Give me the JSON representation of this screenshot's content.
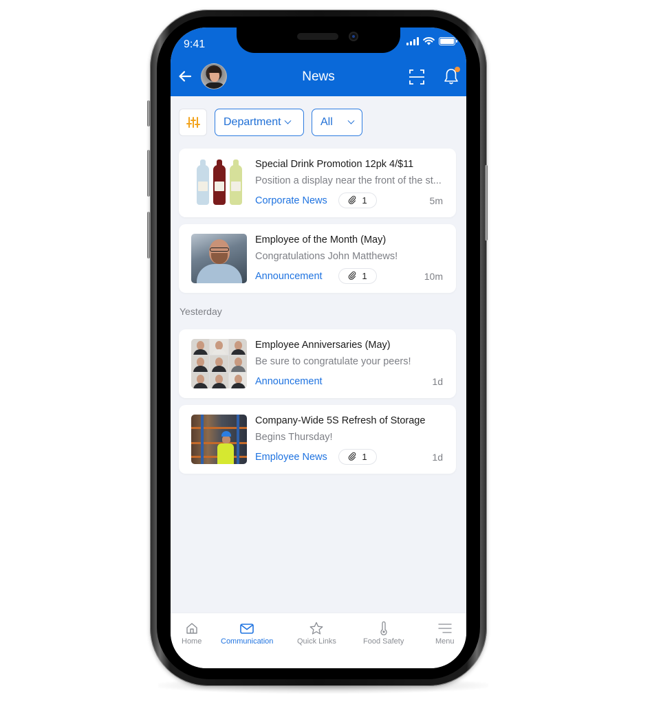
{
  "status_bar": {
    "time": "9:41"
  },
  "header": {
    "title": "News",
    "back_icon": "arrow-left-icon",
    "scan_icon": "scan-icon",
    "notification_icon": "bell-icon",
    "notification_badge_color": "#f5953a",
    "accent_color": "#0a69d9"
  },
  "filters": {
    "filter_icon": "sliders-icon",
    "department_label": "Department",
    "all_label": "All"
  },
  "sections": {
    "yesterday_label": "Yesterday"
  },
  "news": [
    {
      "title": "Special Drink Promotion 12pk 4/$11",
      "subtitle": "Position a display near the front of the st...",
      "category": "Corporate News",
      "attachments": "1",
      "time": "5m",
      "thumbnail": "drink-bottles-image"
    },
    {
      "title": "Employee of the Month (May)",
      "subtitle": "Congratulations John Matthews!",
      "category": "Announcement",
      "attachments": "1",
      "time": "10m",
      "thumbnail": "employee-portrait-image"
    },
    {
      "title": "Employee Anniversaries (May)",
      "subtitle": "Be sure to congratulate your peers!",
      "category": "Announcement",
      "attachments": null,
      "time": "1d",
      "thumbnail": "employee-collage-image"
    },
    {
      "title": "Company-Wide 5S Refresh of Storage",
      "subtitle": "Begins Thursday!",
      "category": "Employee News",
      "attachments": "1",
      "time": "1d",
      "thumbnail": "warehouse-worker-image"
    }
  ],
  "bottom_nav": [
    {
      "label": "Home",
      "icon": "home-icon",
      "active": false
    },
    {
      "label": "Communication",
      "icon": "mail-icon",
      "active": true
    },
    {
      "label": "Quick Links",
      "icon": "star-icon",
      "active": false
    },
    {
      "label": "Food Safety",
      "icon": "thermometer-icon",
      "active": false
    },
    {
      "label": "Menu",
      "icon": "menu-icon",
      "active": false
    }
  ]
}
